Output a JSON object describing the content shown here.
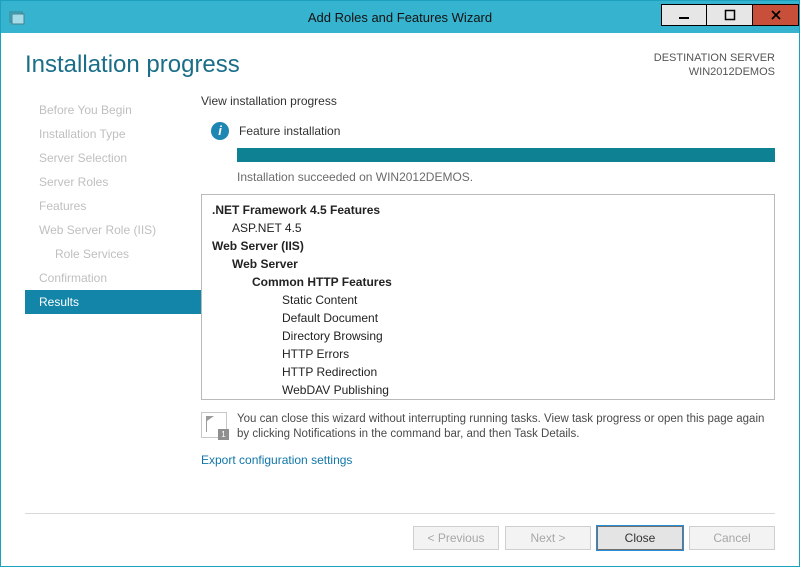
{
  "window": {
    "title": "Add Roles and Features Wizard"
  },
  "header": {
    "page_title": "Installation progress",
    "dest_label": "DESTINATION SERVER",
    "dest_server": "WIN2012DEMOS"
  },
  "sidebar": {
    "steps": [
      {
        "label": "Before You Begin"
      },
      {
        "label": "Installation Type"
      },
      {
        "label": "Server Selection"
      },
      {
        "label": "Server Roles"
      },
      {
        "label": "Features"
      },
      {
        "label": "Web Server Role (IIS)"
      },
      {
        "label": "Role Services",
        "sub": true
      },
      {
        "label": "Confirmation"
      },
      {
        "label": "Results",
        "active": true
      }
    ]
  },
  "pane": {
    "heading": "View installation progress",
    "status": "Feature installation",
    "progress_percent": 100,
    "message": "Installation succeeded on WIN2012DEMOS.",
    "features": [
      {
        "text": ".NET Framework 4.5 Features",
        "cls": "lvl0"
      },
      {
        "text": "ASP.NET 4.5",
        "cls": "lvl1"
      },
      {
        "text": "Web Server (IIS)",
        "cls": "lvl0"
      },
      {
        "text": "Web Server",
        "cls": "lvl1b"
      },
      {
        "text": "Common HTTP Features",
        "cls": "lvl2"
      },
      {
        "text": "Static Content",
        "cls": "lvl3"
      },
      {
        "text": "Default Document",
        "cls": "lvl3"
      },
      {
        "text": "Directory Browsing",
        "cls": "lvl3"
      },
      {
        "text": "HTTP Errors",
        "cls": "lvl3"
      },
      {
        "text": "HTTP Redirection",
        "cls": "lvl3"
      },
      {
        "text": "WebDAV Publishing",
        "cls": "lvl3"
      }
    ],
    "note": "You can close this wizard without interrupting running tasks. View task progress or open this page again by clicking Notifications in the command bar, and then Task Details.",
    "note_badge": "1",
    "export_link": "Export configuration settings"
  },
  "footer": {
    "previous": "< Previous",
    "next": "Next >",
    "close": "Close",
    "cancel": "Cancel"
  }
}
